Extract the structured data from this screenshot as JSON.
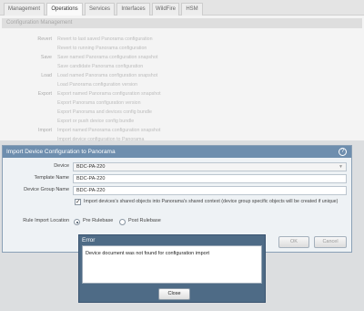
{
  "tabs": [
    "Management",
    "Operations",
    "Services",
    "Interfaces",
    "WildFire",
    "HSM"
  ],
  "section_title": "Configuration Management",
  "config_rows": [
    {
      "group": "Revert",
      "action": "Revert to last saved Panorama configuration"
    },
    {
      "group": "",
      "action": "Revert to running Panorama configuration"
    },
    {
      "group": "Save",
      "action": "Save named Panorama configuration snapshot"
    },
    {
      "group": "",
      "action": "Save candidate Panorama configuration"
    },
    {
      "group": "Load",
      "action": "Load named Panorama configuration snapshot"
    },
    {
      "group": "",
      "action": "Load Panorama configuration version"
    },
    {
      "group": "Export",
      "action": "Export named Panorama configuration snapshot"
    },
    {
      "group": "",
      "action": "Export Panorama configuration version"
    },
    {
      "group": "",
      "action": "Export Panorama and devices config bundle"
    },
    {
      "group": "",
      "action": "Export or push device config bundle"
    },
    {
      "group": "Import",
      "action": "Import named Panorama configuration snapshot"
    },
    {
      "group": "",
      "action": "Import device configuration to Panorama"
    }
  ],
  "import_dialog": {
    "title": "Import Device Configuration to Panorama",
    "help_glyph": "?",
    "device_label": "Device",
    "device_value": "BDC-PA-220",
    "dropdown_glyph": "▼",
    "template_label": "Template Name",
    "template_value": "BDC-PA-220",
    "device_group_label": "Device Group Name",
    "device_group_value": "BDC-PA-220",
    "shared_checkbox_checked": true,
    "check_glyph": "✓",
    "shared_checkbox_text": "Import devices's shared objects into Panorama's shared context (device group specific objects will be created if unique)",
    "rule_import_label": "Rule Import Location",
    "pre_rulebase_label": "Pre Rulebase",
    "post_rulebase_label": "Post Rulebase",
    "selected_location": "Pre Rulebase",
    "ok_label": "OK",
    "cancel_label": "Cancel"
  },
  "error_dialog": {
    "title": "Error",
    "message": "Device document was not found for configuration import",
    "close_label": "Close"
  }
}
